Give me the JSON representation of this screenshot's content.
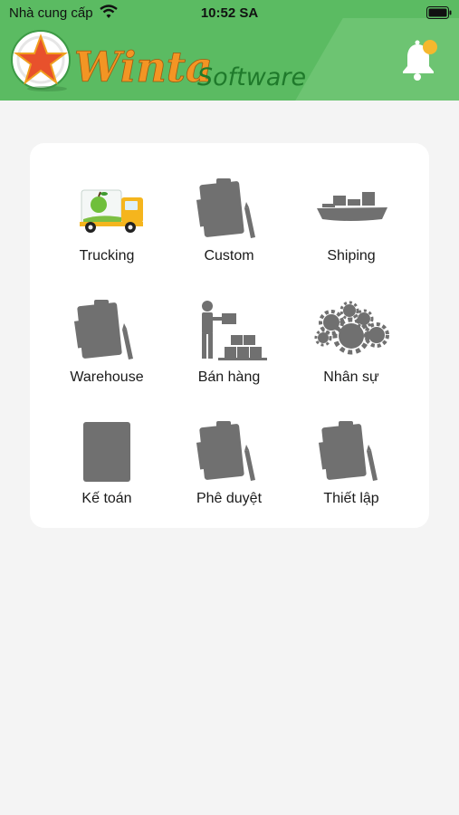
{
  "status_bar": {
    "carrier": "Nhà cung cấp",
    "time": "10:52 SA"
  },
  "header": {
    "brand_name": "Winta",
    "brand_suffix": "Software",
    "notification_badge_color": "#f5b82e",
    "background_color": "#5bbb62"
  },
  "menu": {
    "items": [
      {
        "label": "Trucking",
        "icon": "truck-icon"
      },
      {
        "label": "Custom",
        "icon": "clipboard-icon"
      },
      {
        "label": "Shiping",
        "icon": "ship-icon"
      },
      {
        "label": "Warehouse",
        "icon": "clipboard-icon"
      },
      {
        "label": "Bán hàng",
        "icon": "person-boxes-icon"
      },
      {
        "label": "Nhân sự",
        "icon": "gears-icon"
      },
      {
        "label": "Kế toán",
        "icon": "document-icon"
      },
      {
        "label": "Phê duyệt",
        "icon": "clipboard-icon"
      },
      {
        "label": "Thiết lập",
        "icon": "clipboard-icon"
      }
    ]
  }
}
